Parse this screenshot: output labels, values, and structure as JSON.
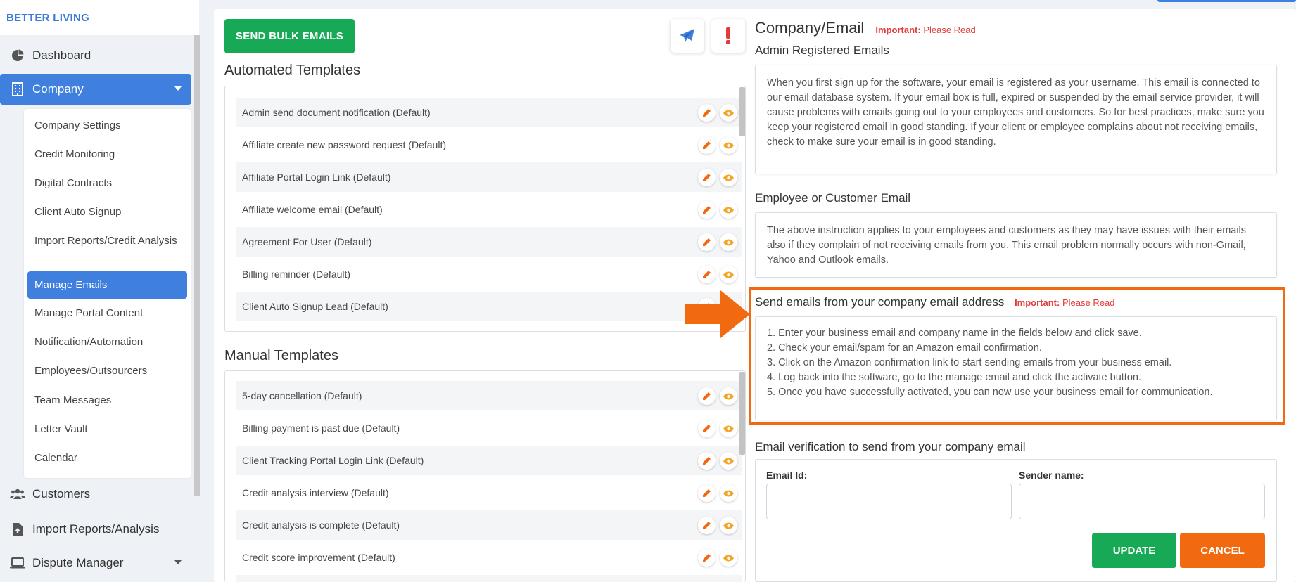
{
  "brand": "BETTER LIVING",
  "sidebar": {
    "items": [
      {
        "label": "Dashboard",
        "icon": "pie-chart-icon"
      },
      {
        "label": "Company",
        "icon": "building-icon"
      },
      {
        "label": "Customers",
        "icon": "users-icon"
      },
      {
        "label": "Import Reports/Analysis",
        "icon": "file-upload-icon"
      },
      {
        "label": "Dispute Manager",
        "icon": "laptop-icon"
      }
    ],
    "submenu": [
      "Company Settings",
      "Credit Monitoring",
      "Digital Contracts",
      "Client Auto Signup",
      "Import Reports/Credit Analysis",
      "Manage Emails",
      "Manage Portal Content",
      "Notification/Automation",
      "Employees/Outsourcers",
      "Team Messages",
      "Letter Vault",
      "Calendar"
    ]
  },
  "toolbar": {
    "bulk_label": "SEND BULK EMAILS"
  },
  "templates": {
    "automated_title": "Automated Templates",
    "automated": [
      "Admin send document notification (Default)",
      "Affiliate create new password request (Default)",
      "Affiliate Portal Login Link (Default)",
      "Affiliate welcome email (Default)",
      "Agreement For User (Default)",
      "Billing reminder (Default)",
      "Client Auto Signup Lead (Default)"
    ],
    "manual_title": "Manual Templates",
    "manual": [
      "5-day cancellation (Default)",
      "Billing payment is past due (Default)",
      "Client Tracking Portal Login Link (Default)",
      "Credit analysis interview (Default)",
      "Credit analysis is complete (Default)",
      "Credit score improvement (Default)"
    ]
  },
  "right": {
    "title": "Company/Email",
    "important_label": "Important:",
    "important_link": "Please Read",
    "admin_title": "Admin Registered Emails",
    "admin_text": "When you first sign up for the software, your email is registered as your username. This email is connected to our email database system. If your email box is full, expired or suspended by the email service provider, it will cause problems with emails going out to your employees and customers. So for best practices, make sure you keep your registered email in good standing. If your client or employee complains about not receiving emails, check to make sure your email is in good standing.",
    "employee_title": "Employee or Customer Email",
    "employee_text": "The above instruction applies to your employees and customers as they may have issues with their emails also if they complain of not receiving emails from you. This email problem normally occurs with non-Gmail, Yahoo and Outlook emails.",
    "send_title": "Send emails from your company email address",
    "steps": [
      "1. Enter your business email and company name in the fields below and click save.",
      "2. Check your email/spam for an Amazon email confirmation.",
      "3. Click on the Amazon confirmation link to start sending emails from your business email.",
      "4. Log back into the software, go to the manage email and click the activate button.",
      "5. Once you have successfully activated, you can now use your business email for communication."
    ],
    "verify_title": "Email verification to send from your company email",
    "email_label": "Email Id:",
    "sender_label": "Sender name:",
    "email_value": "",
    "sender_value": "",
    "update_label": "UPDATE",
    "cancel_label": "CANCEL"
  },
  "colors": {
    "primary": "#3f80de",
    "success": "#18a957",
    "warning": "#f26a10",
    "danger": "#e23b3b"
  }
}
